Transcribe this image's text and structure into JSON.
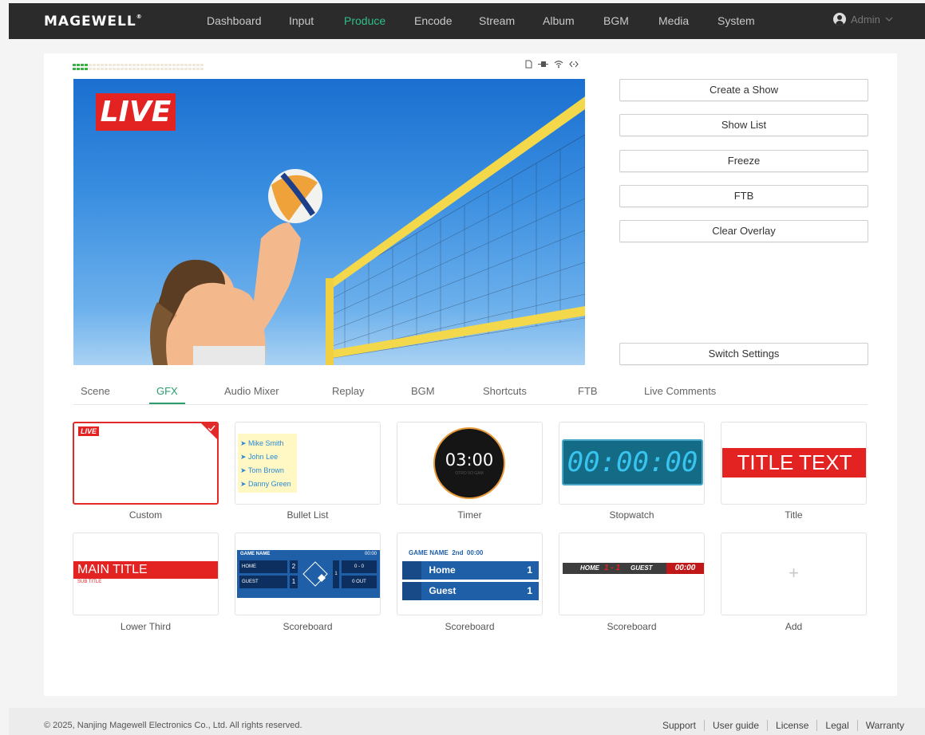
{
  "brand": {
    "logo": "MAGEWELL"
  },
  "nav": {
    "items": [
      {
        "label": "Dashboard"
      },
      {
        "label": "Input"
      },
      {
        "label": "Produce"
      },
      {
        "label": "Encode"
      },
      {
        "label": "Stream"
      },
      {
        "label": "Album"
      },
      {
        "label": "BGM"
      },
      {
        "label": "Media"
      },
      {
        "label": "System"
      }
    ],
    "active": "Produce",
    "user": "Admin"
  },
  "colors": {
    "accent": "#2a9d6a",
    "nav_bg": "#2b2b2b",
    "live_red": "#e32222",
    "scoreboard_blue": "#1f5fa8"
  },
  "preview": {
    "live_badge": "LIVE",
    "status_icons": [
      "sd-card-icon",
      "ethernet-icon",
      "wifi-icon",
      "link-icon"
    ]
  },
  "side_buttons": {
    "create_show": "Create a Show",
    "show_list": "Show List",
    "freeze": "Freeze",
    "ftb": "FTB",
    "clear_overlay": "Clear Overlay",
    "switch_settings": "Switch Settings"
  },
  "tabs": [
    {
      "label": "Scene"
    },
    {
      "label": "GFX"
    },
    {
      "label": "Audio Mixer"
    },
    {
      "label": "Replay"
    },
    {
      "label": "BGM"
    },
    {
      "label": "Shortcuts"
    },
    {
      "label": "FTB"
    },
    {
      "label": "Live Comments"
    }
  ],
  "active_tab": "GFX",
  "gfx": {
    "custom": {
      "label": "Custom",
      "badge": "LIVE"
    },
    "bullet_list": {
      "label": "Bullet List",
      "items": [
        "Mike Smith",
        "John Lee",
        "Tom Brown",
        "Danny Green"
      ]
    },
    "timer": {
      "label": "Timer",
      "time": "03:00",
      "sub": "OTRO 5O GAM"
    },
    "stopwatch": {
      "label": "Stopwatch",
      "time": "00:00:00"
    },
    "title": {
      "label": "Title",
      "text": "TITLE TEXT"
    },
    "lower_third": {
      "label": "Lower Third",
      "main": "MAIN TITLE",
      "sub": "SUB TITLE"
    },
    "scoreboard1": {
      "label": "Scoreboard",
      "game": "GAME NAME",
      "clock": "00:00",
      "home": "HOME",
      "guest": "GUEST",
      "home_score": "2",
      "guest_score": "1",
      "inning": "1",
      "count": "0 - 0",
      "outs": "0 OUT"
    },
    "scoreboard2": {
      "label": "Scoreboard",
      "game": "GAME NAME",
      "period": "2nd",
      "clock": "00:00",
      "home": "Home",
      "guest": "Guest",
      "home_score": "1",
      "guest_score": "1"
    },
    "scoreboard3": {
      "label": "Scoreboard",
      "home": "HOME",
      "score": "1 - 1",
      "guest": "GUEST",
      "clock": "00:00"
    },
    "add": {
      "label": "Add",
      "symbol": "+"
    }
  },
  "footer": {
    "copyright": "© 2025, Nanjing Magewell Electronics Co., Ltd. All rights reserved.",
    "links": [
      "Support",
      "User guide",
      "License",
      "Legal",
      "Warranty"
    ]
  }
}
